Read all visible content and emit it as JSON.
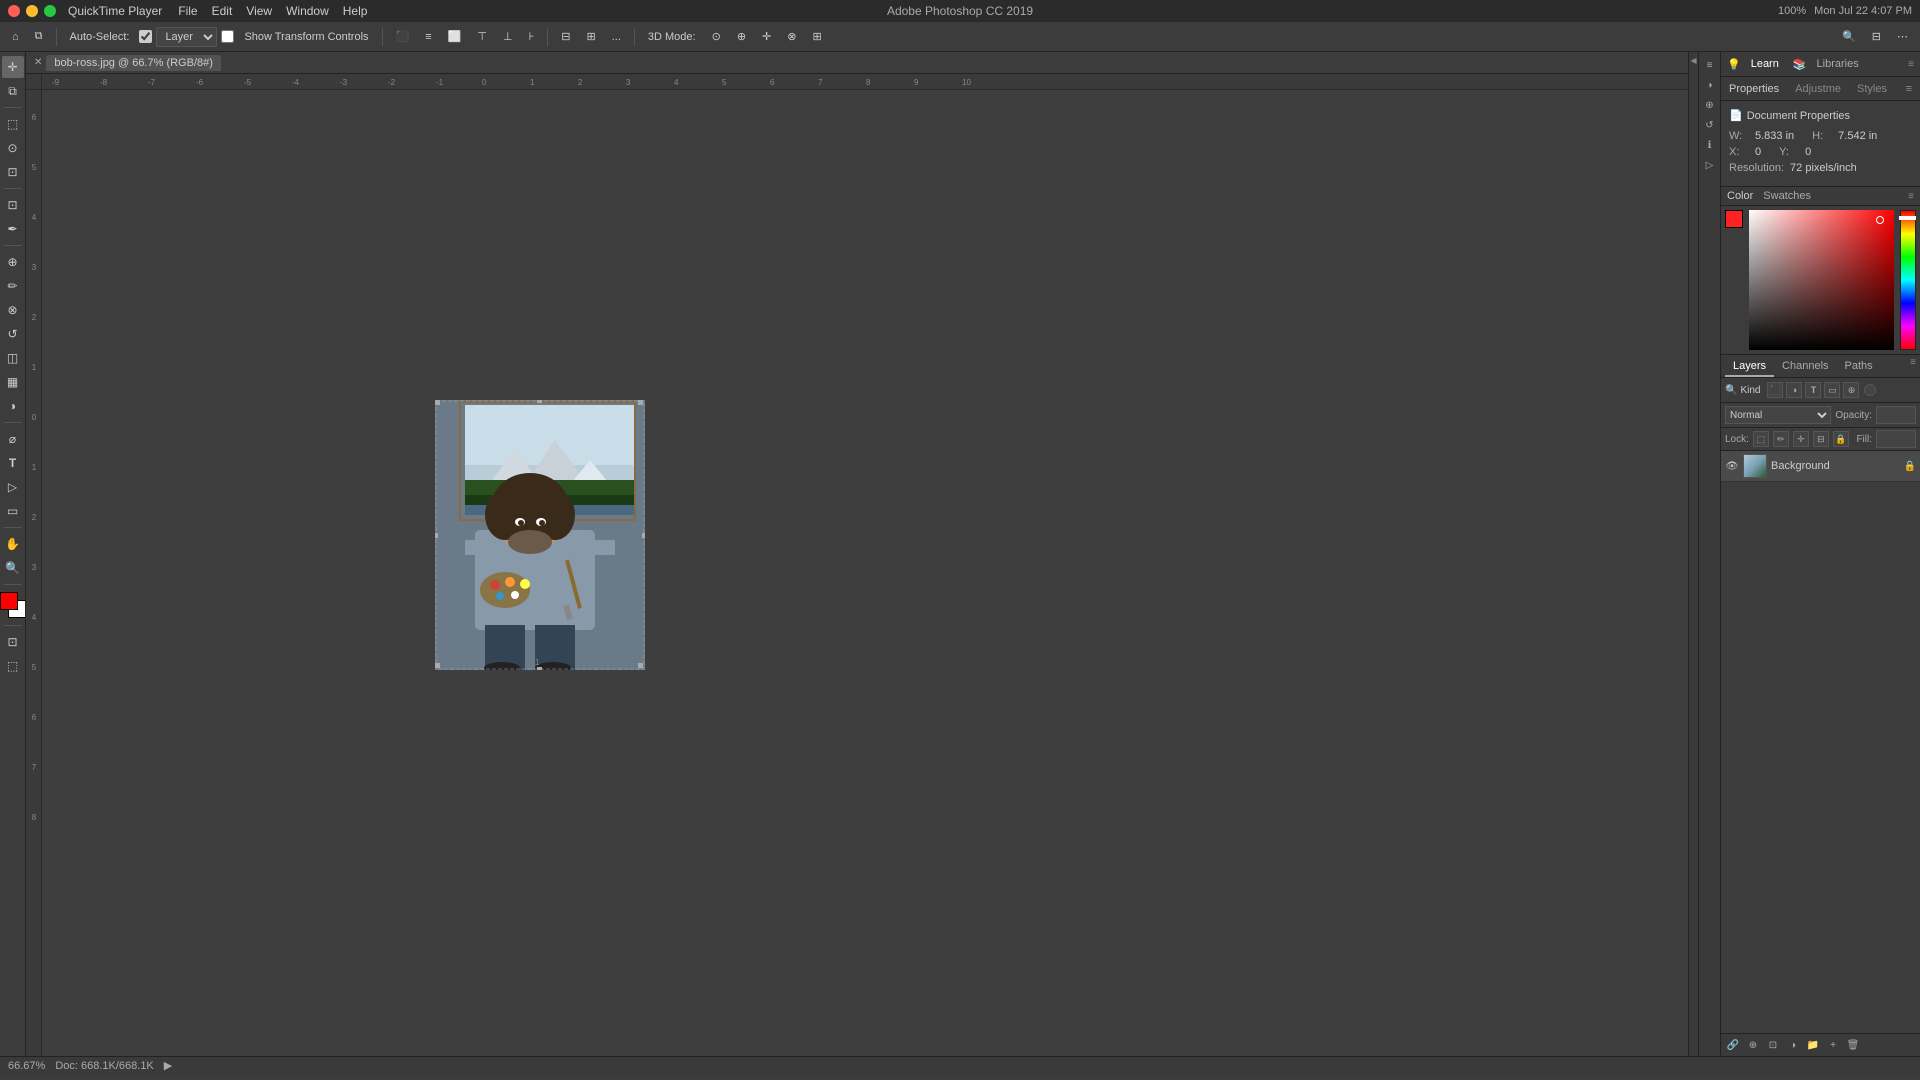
{
  "app": {
    "title": "Adobe Photoshop CC 2019",
    "quicktime_label": "QuickTime Player"
  },
  "mac_menu": {
    "items": [
      "File",
      "Edit",
      "View",
      "Window",
      "Help"
    ]
  },
  "titlebar_right": {
    "zoom": "100%",
    "battery": "■■■■",
    "datetime": "Mon Jul 22  4:07 PM"
  },
  "toolbar_top": {
    "auto_select_label": "Auto-Select:",
    "layer_label": "Layer",
    "show_transform": "Show Transform Controls",
    "mode_3d": "3D Mode:",
    "dots": "..."
  },
  "document": {
    "tab_label": "bob-ross.jpg @ 66.7% (RGB/8#)"
  },
  "properties": {
    "panel_title": "Properties",
    "adjustments_label": "Adjustme",
    "styles_label": "Styles",
    "doc_title": "Document Properties",
    "w_label": "W:",
    "w_value": "5.833 in",
    "h_label": "H:",
    "h_value": "7.542 in",
    "x_label": "X:",
    "x_value": "0",
    "y_label": "Y:",
    "y_value": "0",
    "resolution_label": "Resolution:",
    "resolution_value": "72 pixels/inch"
  },
  "color_panel": {
    "title": "Color",
    "swatches_label": "Swatches"
  },
  "layers_panel": {
    "title": "Layers",
    "channels_label": "Channels",
    "paths_label": "Paths",
    "kind_placeholder": "Kind",
    "blend_mode": "Normal",
    "opacity_label": "Opacity:",
    "opacity_value": "",
    "lock_label": "Lock:",
    "fill_label": "Fill:",
    "fill_value": "",
    "layer_name": "Background"
  },
  "statusbar": {
    "zoom": "66.67%",
    "doc_size": "Doc: 668.1K/668.1K",
    "arrow": "▶"
  },
  "learn": {
    "label": "Learn"
  },
  "libraries": {
    "label": "Libraries"
  },
  "tools": {
    "list": [
      {
        "name": "move-tool",
        "icon": "✛"
      },
      {
        "name": "artboard-tool",
        "icon": "⊞"
      },
      {
        "name": "marquee-tool",
        "icon": "⬚"
      },
      {
        "name": "lasso-tool",
        "icon": "⊙"
      },
      {
        "name": "crop-tool",
        "icon": "⊡"
      },
      {
        "name": "eyedropper-tool",
        "icon": "✒"
      },
      {
        "name": "healing-brush-tool",
        "icon": "⊕"
      },
      {
        "name": "brush-tool",
        "icon": "✏"
      },
      {
        "name": "clone-stamp-tool",
        "icon": "⊗"
      },
      {
        "name": "history-brush-tool",
        "icon": "↺"
      },
      {
        "name": "eraser-tool",
        "icon": "◫"
      },
      {
        "name": "gradient-tool",
        "icon": "▦"
      },
      {
        "name": "dodge-tool",
        "icon": "◑"
      },
      {
        "name": "pen-tool",
        "icon": "⌀"
      },
      {
        "name": "path-selection-tool",
        "icon": "▷"
      },
      {
        "name": "text-tool",
        "icon": "T"
      },
      {
        "name": "shape-tool",
        "icon": "▭"
      },
      {
        "name": "hand-tool",
        "icon": "✋"
      },
      {
        "name": "zoom-tool",
        "icon": "🔍"
      },
      {
        "name": "extra-tools",
        "icon": "…"
      }
    ]
  }
}
